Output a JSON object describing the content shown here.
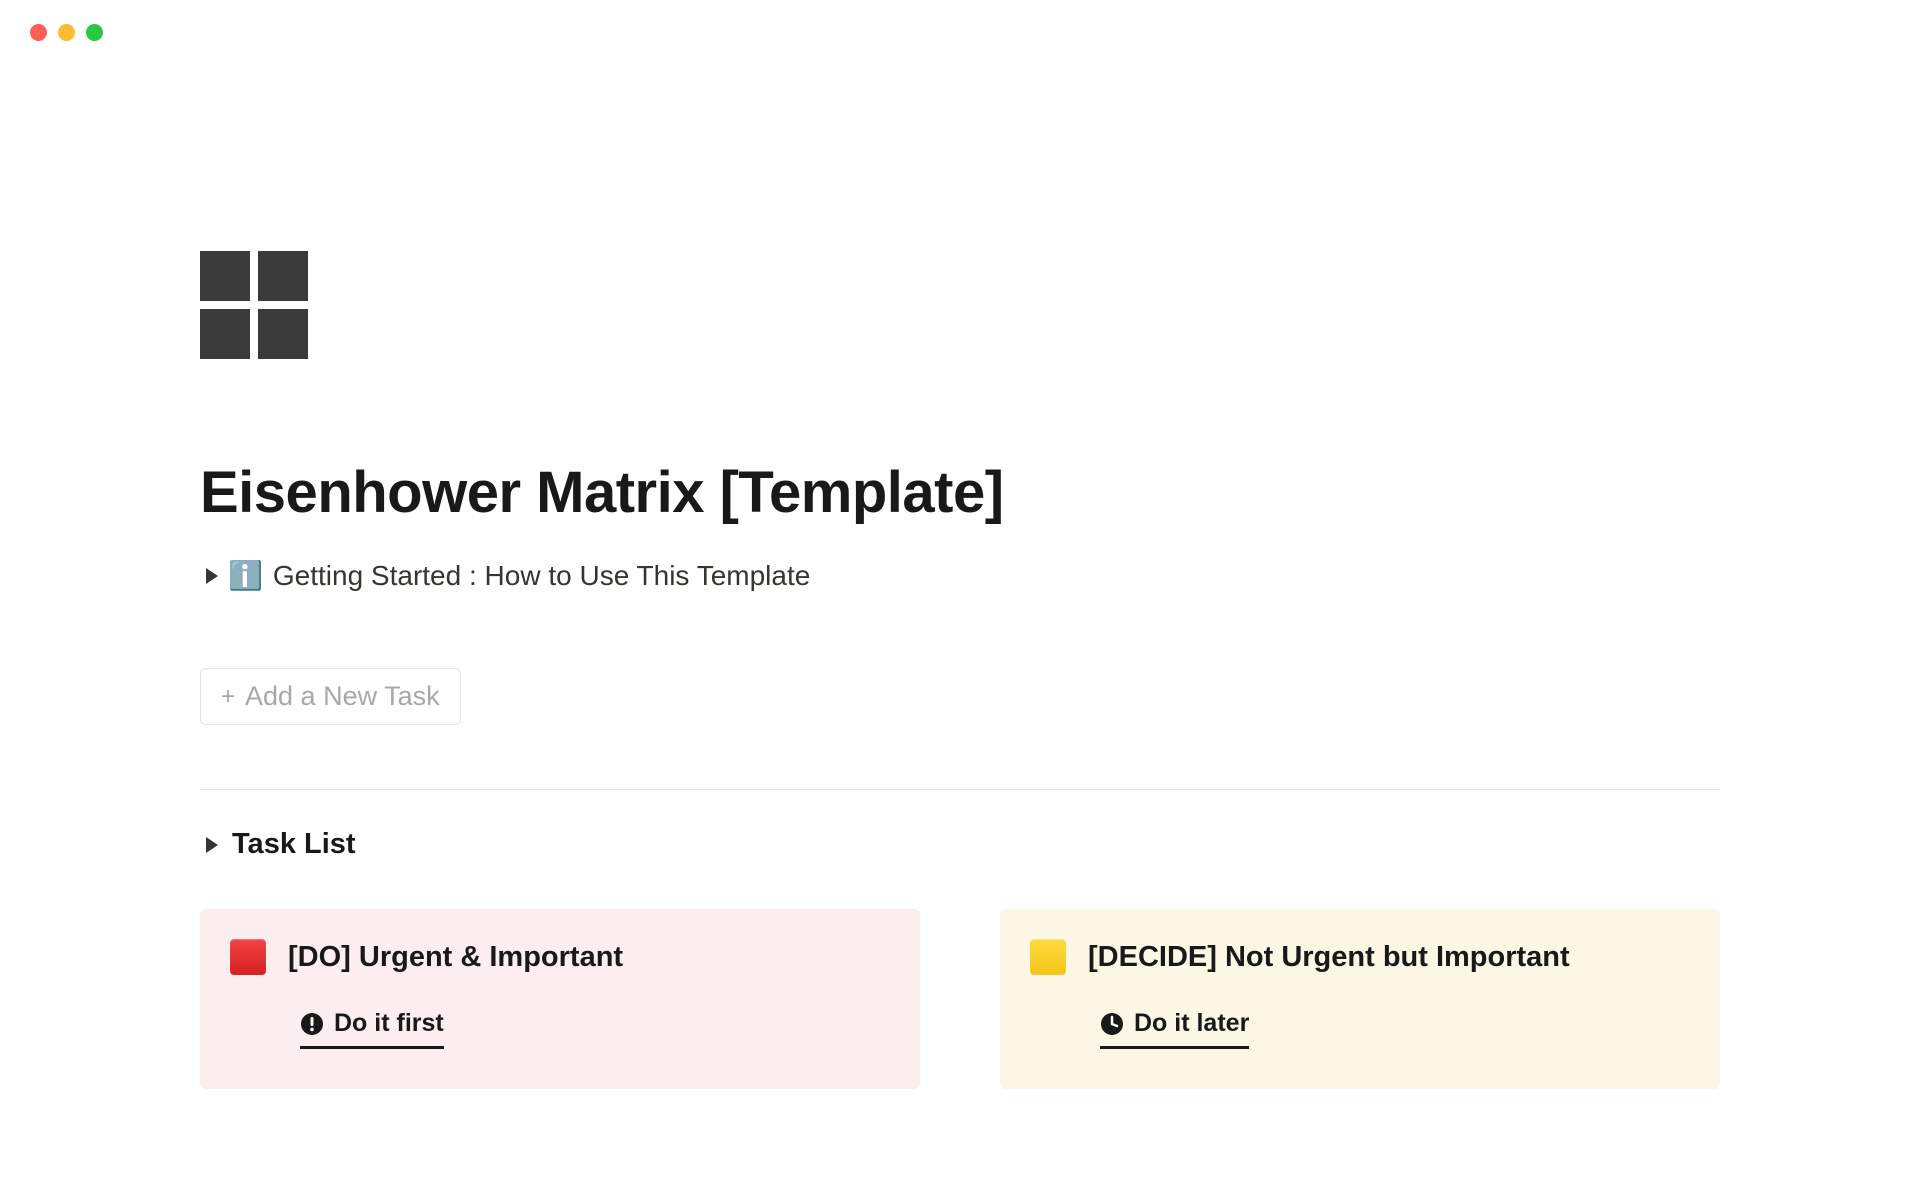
{
  "page": {
    "title": "Eisenhower Matrix [Template]"
  },
  "toggle_getting_started": {
    "emoji": "ℹ️",
    "text": "Getting Started : How to Use This Template"
  },
  "add_task": {
    "label": "Add a New Task"
  },
  "task_list": {
    "label": "Task List"
  },
  "matrix": {
    "do": {
      "title": "[DO]  Urgent & Important",
      "tab_label": "Do it first"
    },
    "decide": {
      "title": "[DECIDE]  Not Urgent but Important",
      "tab_label": "Do it later"
    }
  }
}
